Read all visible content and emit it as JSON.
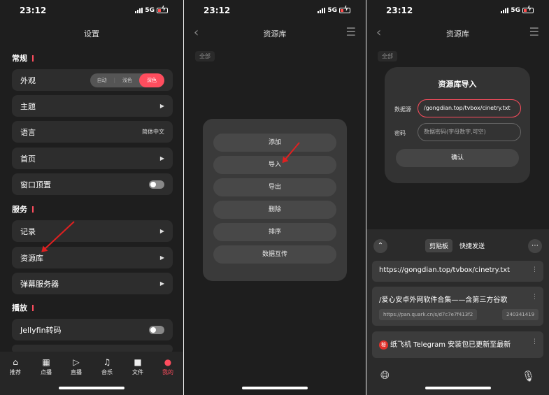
{
  "status": {
    "time": "23:12",
    "network": "5G"
  },
  "settings": {
    "title": "设置",
    "sections": {
      "general": "常规",
      "service": "服务",
      "play": "播放"
    },
    "appearance": {
      "label": "外观",
      "options": [
        "自动",
        "浅色",
        "深色"
      ],
      "selected": "深色"
    },
    "theme": "主题",
    "language": {
      "label": "语言",
      "value": "简体中文"
    },
    "homepage": "首页",
    "pin_window": "窗口顶置",
    "records": "记录",
    "resource_library": "资源库",
    "danmaku_server": "弹幕服务器",
    "jellyfin": "Jellyfin转码"
  },
  "tabbar": [
    "推荐",
    "点播",
    "直播",
    "音乐",
    "文件",
    "我的"
  ],
  "library": {
    "title": "资源库",
    "chip": "全部",
    "menu": [
      "添加",
      "导入",
      "导出",
      "删除",
      "排序",
      "数据互传"
    ]
  },
  "import_dialog": {
    "title": "资源库导入",
    "source_label": "数据源",
    "source_value": "/gongdian.top/tvbox/cinetry.txt",
    "password_label": "密码",
    "password_placeholder": "数据密码(字母数字,可空)",
    "confirm": "确认"
  },
  "keyboard": {
    "tabs": [
      "剪贴板",
      "快捷发送"
    ],
    "clips": [
      {
        "text": "https://gongdian.top/tvbox/cinetry.txt"
      },
      {
        "text": "/爱心安卓外网软件合集——含第三方谷歌",
        "chips": [
          "https://pan.quark.cn/s/d7c7e7f413f2",
          "240341419"
        ]
      },
      {
        "badge": "秘",
        "text": "纸飞机 Telegram 安装包已更新至最新"
      }
    ]
  },
  "colors": {
    "accent": "#ff4d5e",
    "arrow": "#e02020",
    "background": "#1e1e1e"
  }
}
